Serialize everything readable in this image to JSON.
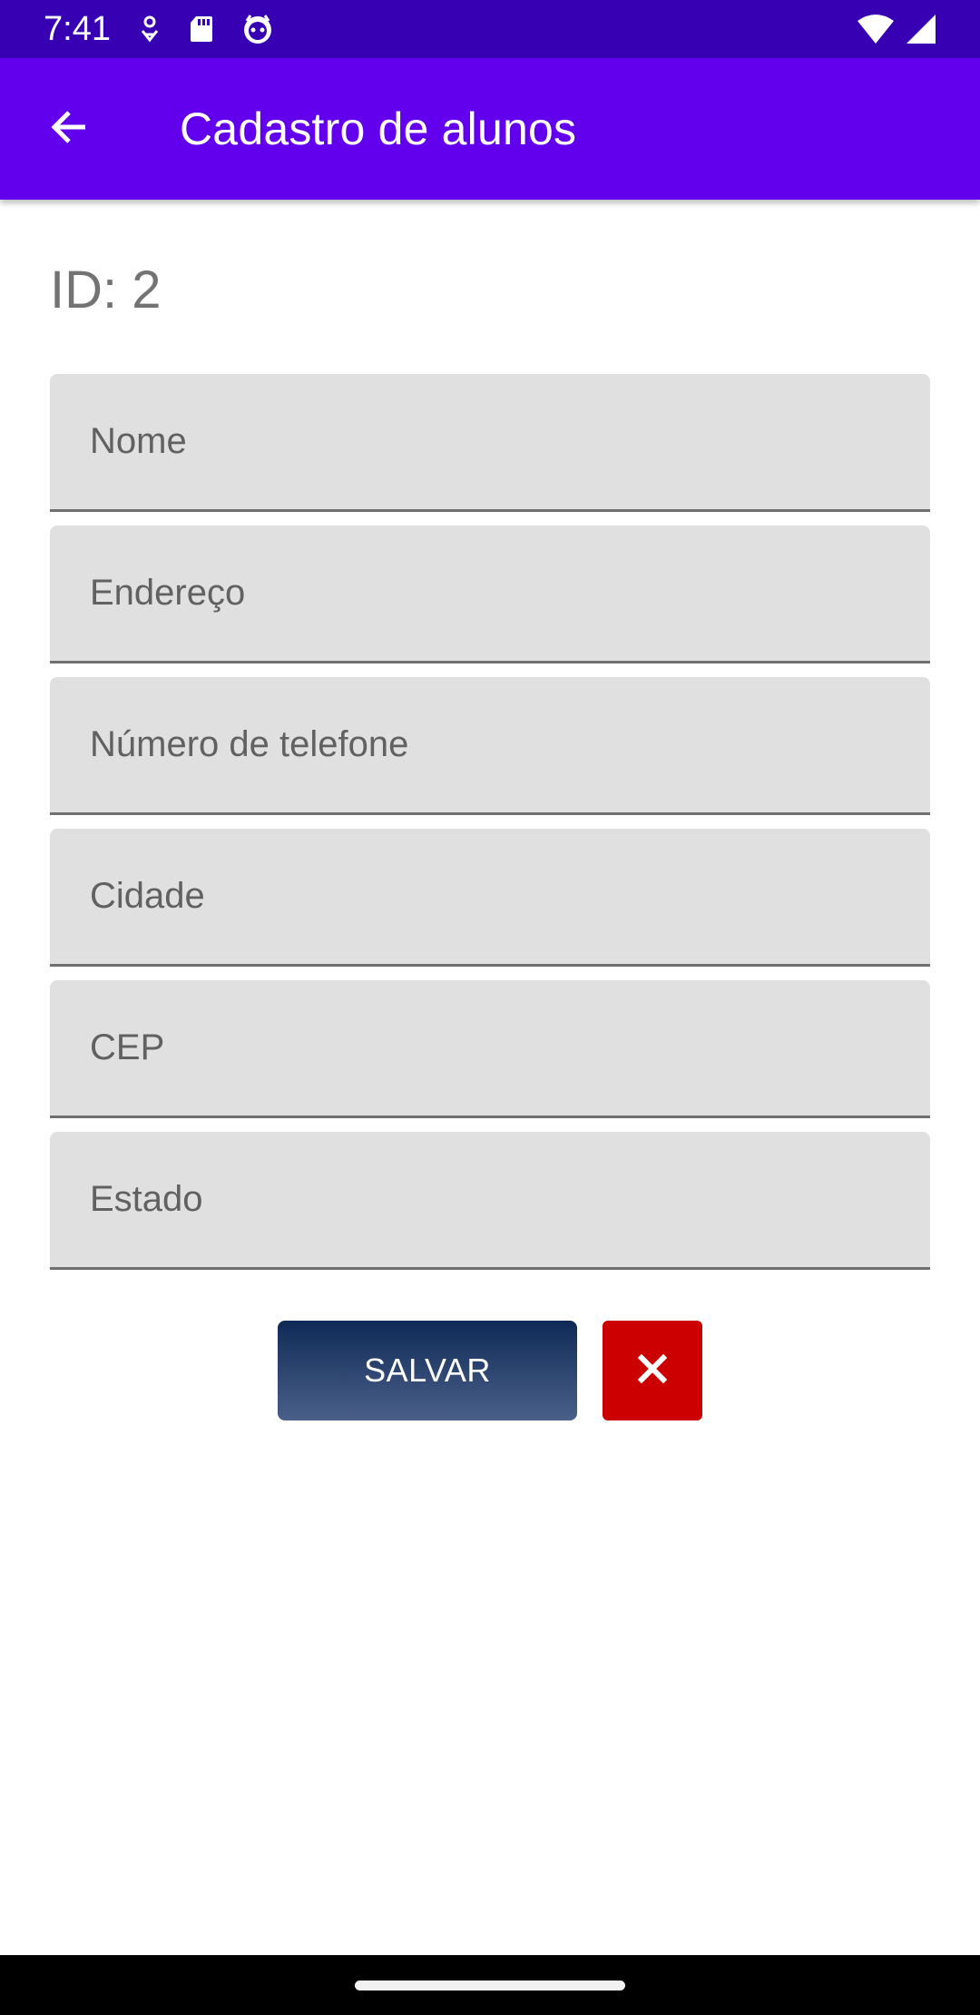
{
  "status_bar": {
    "time": "7:41",
    "left_icons": [
      "location-sensor-icon",
      "sd-card-icon",
      "robot-face-icon"
    ],
    "right_icons": [
      "wifi-icon",
      "cell-signal-icon"
    ]
  },
  "app_bar": {
    "title": "Cadastro de alunos",
    "back_icon": "arrow-back-icon"
  },
  "form": {
    "id_label": "ID: 2",
    "fields": [
      {
        "placeholder": "Nome",
        "value": ""
      },
      {
        "placeholder": "Endereço",
        "value": ""
      },
      {
        "placeholder": "Número de telefone",
        "value": ""
      },
      {
        "placeholder": "Cidade",
        "value": ""
      },
      {
        "placeholder": "CEP",
        "value": ""
      },
      {
        "placeholder": "Estado",
        "value": ""
      }
    ],
    "save_label": "SALVAR",
    "cancel_icon": "close-icon"
  },
  "colors": {
    "status_bar": "#3700b3",
    "app_bar": "#6200ee",
    "field_bg": "#e0e0e0",
    "save_button": "#1f3a68",
    "cancel_button": "#cc0000"
  }
}
